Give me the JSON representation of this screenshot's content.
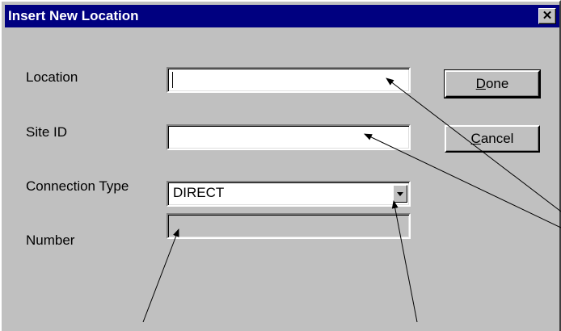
{
  "dialog": {
    "title": "Insert New Location",
    "close_glyph": "✕"
  },
  "form": {
    "location_label": "Location",
    "location_value": "",
    "site_id_label": "Site ID",
    "site_id_value": "",
    "connection_type_label": "Connection Type",
    "connection_type_value": "DIRECT",
    "number_label": "Number",
    "number_value": ""
  },
  "buttons": {
    "done": {
      "mnemonic": "D",
      "rest": "one"
    },
    "cancel": {
      "mnemonic": "C",
      "rest": "ancel"
    }
  }
}
